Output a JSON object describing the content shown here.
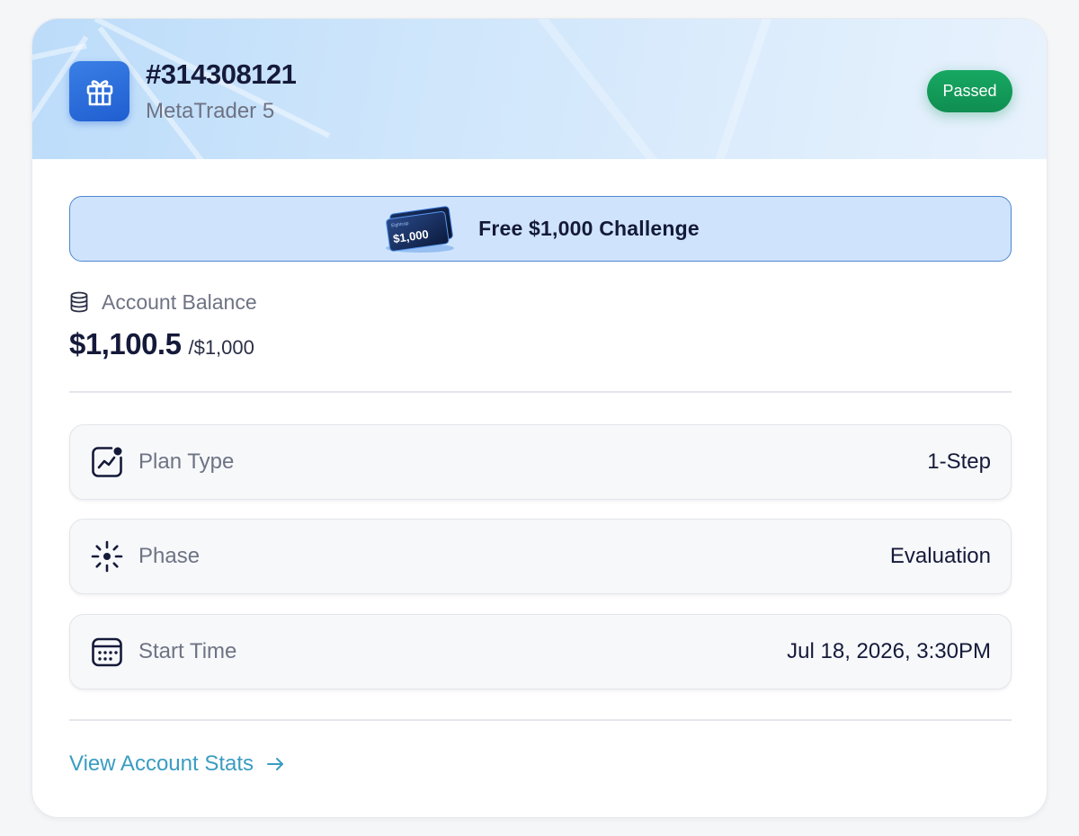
{
  "account": {
    "number": "#314308121",
    "platform": "MetaTrader 5",
    "status": "Passed",
    "status_color": "#13a05b",
    "logo_icon": "gift-icon"
  },
  "challenge": {
    "label": "Free $1,000 Challenge",
    "card_text": "$1,000",
    "card_brand": "Eightcap"
  },
  "balance": {
    "label": "Account Balance",
    "icon": "coins-stack-icon",
    "current": "$1,100.5",
    "initial": "/$1,000"
  },
  "details": [
    {
      "label": "Plan Type",
      "value": "1-Step",
      "icon": "trend-chart-icon"
    },
    {
      "label": "Phase",
      "value": "Evaluation",
      "icon": "sun-burst-icon"
    },
    {
      "label": "Start Time",
      "value": "Jul 18, 2026, 3:30PM",
      "icon": "calendar-icon"
    }
  ],
  "link": {
    "label": "View Account Stats",
    "icon": "arrow-right-icon",
    "color": "#3a9cc2"
  }
}
